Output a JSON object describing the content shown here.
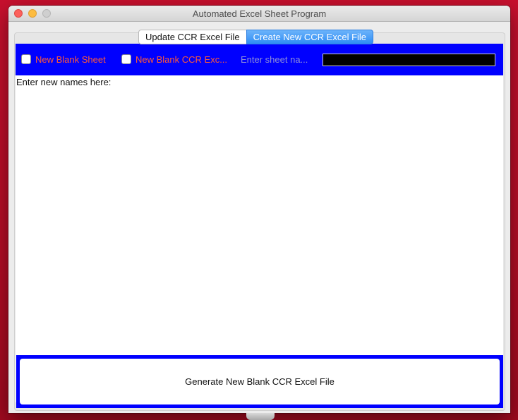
{
  "window": {
    "title": "Automated Excel Sheet Program"
  },
  "tabs": [
    {
      "label": "Update CCR Excel File",
      "selected": false
    },
    {
      "label": "Create New CCR Excel File",
      "selected": true
    }
  ],
  "toolbar": {
    "new_blank_sheet_label": "New Blank Sheet",
    "new_blank_ccr_label": "New Blank CCR Exc...",
    "sheet_name_label": "Enter sheet na...",
    "sheet_name_value": ""
  },
  "names": {
    "label": "Enter new names here:",
    "value": ""
  },
  "actions": {
    "generate_label": "Generate New Blank CCR Excel File"
  },
  "colors": {
    "accent_blue": "#0000ff",
    "checkbox_label": "#ff5a36",
    "selected_tab": "#2e8cf5"
  }
}
